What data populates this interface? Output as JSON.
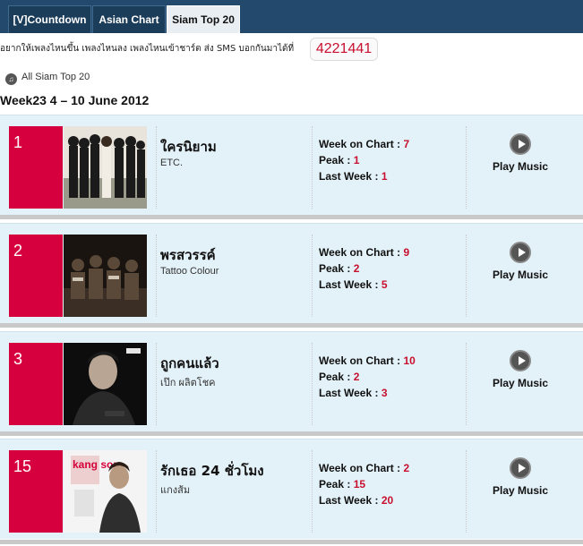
{
  "tabs": [
    {
      "label": "[V]Countdown"
    },
    {
      "label": "Asian Chart"
    },
    {
      "label": "Siam Top 20",
      "active": true
    }
  ],
  "sms": {
    "text": "อยากให้เพลงไหนขึ้น เพลงไหนลง เพลงไหนเข้าชาร์ต ส่ง SMS บอกกันมาได้ที่",
    "number": "4221441"
  },
  "all_link": "All Siam Top 20",
  "week_title": "Week23 4 – 10 June 2012",
  "labels": {
    "week_on_chart": "Week on Chart : ",
    "peak": "Peak : ",
    "last_week": "Last Week : ",
    "play_music": "Play Music"
  },
  "entries": [
    {
      "rank": "1",
      "song": "ใครนิยาม",
      "artist": "ETC.",
      "week_on_chart": "7",
      "peak": "1",
      "last_week": "1"
    },
    {
      "rank": "2",
      "song": "พรสวรรค์",
      "artist": "Tattoo Colour",
      "week_on_chart": "9",
      "peak": "2",
      "last_week": "5"
    },
    {
      "rank": "3",
      "song": "ถูกคนแล้ว",
      "artist": "เป๊ก ผลิตโชค",
      "week_on_chart": "10",
      "peak": "2",
      "last_week": "3"
    },
    {
      "rank": "15",
      "song": "รักเธอ 24 ชั่วโมง",
      "artist": "แกงส้ม",
      "week_on_chart": "2",
      "peak": "15",
      "last_week": "20"
    }
  ],
  "cover_text": {
    "kang_som_logo": "kang som"
  },
  "colors": {
    "topbar": "#234a6c",
    "rank_bg": "#d6003e",
    "row_bg": "#e3f1f8",
    "value_red": "#c8102e"
  }
}
